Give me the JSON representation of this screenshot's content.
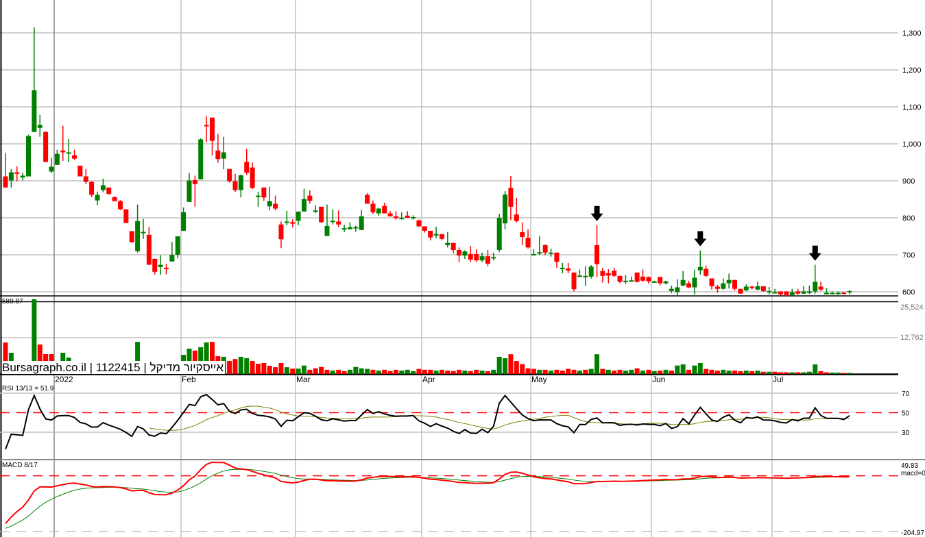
{
  "header": {
    "brand_label": "Bursagraph.co.il | 1122415 | אייסקיור מדיקל",
    "volume_price_label": "589.87",
    "rsi_label": "RSI 13/13 = 51.9",
    "macd_label": "MACD 8/17"
  },
  "colors": {
    "up": "#008000",
    "down": "#ff0000",
    "rsi": "#000000",
    "rsi_signal": "#808000",
    "macd": "#ff0000",
    "macd_signal": "#008000",
    "grid": "#c0c0c0"
  },
  "chart_data": [
    {
      "type": "candlestick",
      "title": "Bursagraph.co.il | 1122415 | אייסקיור מדיקל",
      "x_labels": [
        {
          "label": "2022",
          "index": 9
        },
        {
          "label": "Feb",
          "index": 31
        },
        {
          "label": "Mar",
          "index": 51
        },
        {
          "label": "Apr",
          "index": 73
        },
        {
          "label": "May",
          "index": 92
        },
        {
          "label": "Jun",
          "index": 113
        },
        {
          "label": "Jul",
          "index": 134
        }
      ],
      "y_ticks": [
        "1,300",
        "1,200",
        "1,100",
        "1,000",
        "900",
        "800",
        "700",
        "600"
      ],
      "y_tick_values": [
        1300,
        1200,
        1100,
        1000,
        900,
        800,
        700,
        600
      ],
      "ylim": [
        600,
        1300
      ],
      "ohlc_fields": [
        "open",
        "high",
        "low",
        "close"
      ],
      "ohlc": [
        [
          912,
          975,
          882,
          882
        ],
        [
          901,
          932,
          882,
          923
        ],
        [
          923,
          939,
          899,
          919
        ],
        [
          909,
          922,
          901,
          914
        ],
        [
          912,
          1025,
          912,
          1021
        ],
        [
          1032,
          1315,
          1032,
          1145
        ],
        [
          1043,
          1078,
          1019,
          1051
        ],
        [
          1032,
          1034,
          951,
          951
        ],
        [
          925,
          962,
          921,
          938
        ],
        [
          943,
          984,
          943,
          973
        ],
        [
          982,
          1049,
          954,
          977
        ],
        [
          976,
          1013,
          950,
          977
        ],
        [
          969,
          984,
          956,
          960
        ],
        [
          941,
          941,
          912,
          912
        ],
        [
          912,
          932,
          891,
          897
        ],
        [
          897,
          899,
          856,
          862
        ],
        [
          847,
          871,
          834,
          862
        ],
        [
          875,
          906,
          869,
          888
        ],
        [
          882,
          882,
          862,
          865
        ],
        [
          856,
          858,
          845,
          845
        ],
        [
          845,
          848,
          821,
          823
        ],
        [
          823,
          823,
          786,
          786
        ],
        [
          764,
          764,
          734,
          734
        ],
        [
          710,
          836,
          706,
          791
        ],
        [
          762,
          797,
          743,
          762
        ],
        [
          754,
          776,
          673,
          673
        ],
        [
          689,
          690,
          647,
          654
        ],
        [
          667,
          699,
          646,
          673
        ],
        [
          665,
          676,
          647,
          662
        ],
        [
          682,
          735,
          682,
          700
        ],
        [
          700,
          750,
          690,
          750
        ],
        [
          765,
          828,
          765,
          815
        ],
        [
          843,
          921,
          843,
          901
        ],
        [
          902,
          914,
          830,
          891
        ],
        [
          904,
          1015,
          904,
          1012
        ],
        [
          1051,
          1075,
          1004,
          1050
        ],
        [
          1071,
          1071,
          969,
          1008
        ],
        [
          982,
          1027,
          949,
          959
        ],
        [
          960,
          1019,
          931,
          977
        ],
        [
          932,
          932,
          895,
          899
        ],
        [
          899,
          919,
          870,
          875
        ],
        [
          875,
          917,
          855,
          915
        ],
        [
          951,
          986,
          916,
          922
        ],
        [
          936,
          949,
          878,
          881
        ],
        [
          860,
          870,
          830,
          860
        ],
        [
          882,
          882,
          846,
          855
        ],
        [
          831,
          884,
          820,
          845
        ],
        [
          838,
          860,
          820,
          825
        ],
        [
          782,
          790,
          718,
          742
        ],
        [
          790,
          819,
          780,
          790
        ],
        [
          788,
          796,
          774,
          784
        ],
        [
          792,
          817,
          780,
          817
        ],
        [
          817,
          878,
          817,
          851
        ],
        [
          860,
          875,
          838,
          846
        ],
        [
          820,
          834,
          813,
          820
        ],
        [
          830,
          830,
          786,
          788
        ],
        [
          751,
          836,
          751,
          778
        ],
        [
          792,
          823,
          782,
          792
        ],
        [
          790,
          820,
          775,
          782
        ],
        [
          772,
          781,
          761,
          772
        ],
        [
          769,
          788,
          769,
          775
        ],
        [
          775,
          779,
          762,
          775
        ],
        [
          767,
          821,
          767,
          804
        ],
        [
          862,
          867,
          838,
          838
        ],
        [
          838,
          847,
          810,
          815
        ],
        [
          812,
          827,
          806,
          825
        ],
        [
          832,
          841,
          812,
          812
        ],
        [
          812,
          818,
          804,
          804
        ],
        [
          804,
          818,
          795,
          799
        ],
        [
          800,
          815,
          795,
          800
        ],
        [
          806,
          818,
          800,
          800
        ],
        [
          802,
          807,
          795,
          802
        ],
        [
          793,
          795,
          775,
          777
        ],
        [
          777,
          777,
          760,
          765
        ],
        [
          765,
          765,
          739,
          747
        ],
        [
          756,
          776,
          745,
          756
        ],
        [
          756,
          756,
          739,
          743
        ],
        [
          726,
          761,
          720,
          732
        ],
        [
          732,
          732,
          704,
          713
        ],
        [
          713,
          720,
          680,
          698
        ],
        [
          698,
          712,
          689,
          709
        ],
        [
          702,
          724,
          680,
          687
        ],
        [
          702,
          715,
          680,
          685
        ],
        [
          685,
          706,
          680,
          696
        ],
        [
          696,
          713,
          669,
          676
        ],
        [
          694,
          706,
          685,
          694
        ],
        [
          713,
          811,
          707,
          800
        ],
        [
          785,
          872,
          769,
          863
        ],
        [
          881,
          913,
          794,
          830
        ],
        [
          809,
          854,
          787,
          791
        ],
        [
          761,
          787,
          726,
          748
        ],
        [
          746,
          769,
          717,
          720
        ],
        [
          702,
          715,
          700,
          702
        ],
        [
          704,
          750,
          700,
          707
        ],
        [
          726,
          728,
          699,
          706
        ],
        [
          706,
          717,
          695,
          706
        ],
        [
          706,
          706,
          665,
          681
        ],
        [
          665,
          678,
          650,
          665
        ],
        [
          663,
          678,
          650,
          657
        ],
        [
          652,
          652,
          601,
          607
        ],
        [
          644,
          660,
          639,
          644
        ],
        [
          643,
          669,
          616,
          643
        ],
        [
          641,
          672,
          636,
          668
        ],
        [
          726,
          780,
          639,
          675
        ],
        [
          656,
          665,
          625,
          643
        ],
        [
          650,
          661,
          623,
          644
        ],
        [
          657,
          665,
          640,
          643
        ],
        [
          643,
          643,
          623,
          627
        ],
        [
          627,
          645,
          621,
          630
        ],
        [
          631,
          641,
          627,
          631
        ],
        [
          652,
          652,
          625,
          627
        ],
        [
          641,
          660,
          627,
          630
        ],
        [
          640,
          641,
          622,
          628
        ],
        [
          628,
          630,
          626,
          628
        ],
        [
          640,
          640,
          617,
          623
        ],
        [
          623,
          630,
          620,
          628
        ],
        [
          602,
          617,
          596,
          608
        ],
        [
          599,
          634,
          590,
          612
        ],
        [
          617,
          656,
          615,
          632
        ],
        [
          623,
          630,
          610,
          612
        ],
        [
          612,
          660,
          593,
          638
        ],
        [
          658,
          712,
          646,
          667
        ],
        [
          662,
          671,
          640,
          643
        ],
        [
          636,
          636,
          606,
          615
        ],
        [
          614,
          619,
          597,
          608
        ],
        [
          608,
          636,
          605,
          623
        ],
        [
          623,
          649,
          609,
          632
        ],
        [
          632,
          632,
          603,
          608
        ],
        [
          608,
          608,
          595,
          595
        ],
        [
          604,
          620,
          602,
          614
        ],
        [
          614,
          617,
          606,
          610
        ],
        [
          606,
          627,
          604,
          615
        ],
        [
          615,
          615,
          600,
          602
        ],
        [
          602,
          613,
          593,
          602
        ],
        [
          599,
          608,
          597,
          599
        ],
        [
          601,
          601,
          590,
          593
        ],
        [
          601,
          601,
          589,
          591
        ],
        [
          591,
          608,
          590,
          599
        ],
        [
          601,
          608,
          592,
          595
        ],
        [
          595,
          615,
          594,
          601
        ],
        [
          597,
          617,
          594,
          601
        ],
        [
          601,
          673,
          595,
          627
        ],
        [
          614,
          627,
          602,
          606
        ],
        [
          597,
          610,
          596,
          597
        ],
        [
          597,
          601,
          596,
          597
        ],
        [
          597,
          601,
          593,
          597
        ],
        [
          598,
          599,
          593,
          594
        ],
        [
          599,
          604,
          593,
          602
        ]
      ],
      "arrow_markers_at_index": [
        103,
        121,
        141
      ]
    },
    {
      "type": "bar",
      "title": "Volume",
      "y_ticks": [
        "25,524",
        "12,762"
      ],
      "y_tick_values": [
        25524,
        12762
      ],
      "ylim": [
        0,
        25524
      ],
      "values": [
        11180,
        7540,
        0,
        0,
        0,
        26500,
        10450,
        7050,
        7050,
        0,
        7540,
        5830,
        0,
        0,
        0,
        0,
        0,
        0,
        0,
        0,
        0,
        0,
        0,
        11400,
        0,
        3000,
        0,
        0,
        0,
        0,
        0,
        6800,
        9000,
        8300,
        9500,
        11200,
        11400,
        6300,
        6100,
        4600,
        5300,
        6100,
        5600,
        4600,
        3600,
        3900,
        2900,
        2400,
        3900,
        2400,
        1900,
        1900,
        3000,
        1500,
        2000,
        2500,
        1500,
        1200,
        1500,
        1000,
        1500,
        2500,
        2000,
        1800,
        1500,
        1200,
        1500,
        1000,
        1500,
        1200,
        1500,
        1000,
        1800,
        1500,
        1500,
        1200,
        1500,
        1200,
        1000,
        1500,
        1200,
        1000,
        1500,
        1200,
        1000,
        1500,
        6100,
        5600,
        7000,
        4600,
        3500,
        2000,
        1800,
        1500,
        1500,
        1200,
        1500,
        1200,
        1800,
        1500,
        1200,
        1500,
        1800,
        7000,
        1800,
        1500,
        1200,
        1500,
        1200,
        1500,
        2000,
        1200,
        1500,
        1000,
        1200,
        1500,
        1200,
        3000,
        3400,
        1500,
        3000,
        3900,
        1800,
        1500,
        1200,
        1500,
        1200,
        1200,
        1000,
        1200,
        1000,
        1200,
        800,
        800,
        800,
        600,
        600,
        600,
        600,
        600,
        800,
        3400,
        1000,
        600,
        500,
        500,
        400,
        400
      ]
    },
    {
      "type": "line",
      "title": "RSI 13/13 = 51.9",
      "period": 13,
      "signal_period": 13,
      "y_ticks": [
        "70",
        "50",
        "30"
      ],
      "y_tick_values": [
        70,
        50,
        30
      ],
      "reference_line": 50,
      "last_value": 51.9
    },
    {
      "type": "line",
      "title": "MACD 8/17",
      "fast": 8,
      "slow": 17,
      "y_ticks": [
        "49.83",
        "macd=0",
        "-204.97"
      ],
      "ylim": [
        -204.97,
        49.83
      ]
    }
  ]
}
